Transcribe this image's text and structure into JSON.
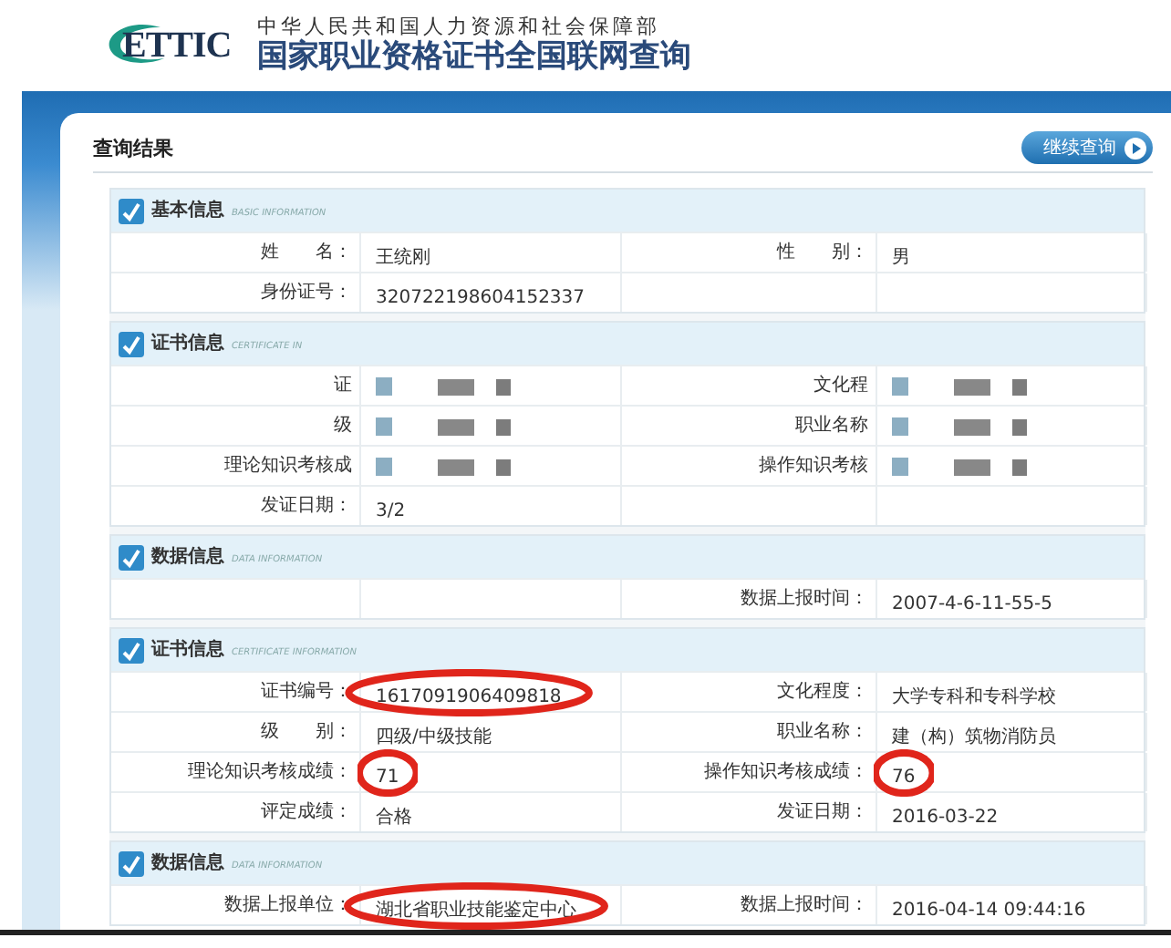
{
  "header": {
    "logo_text": "ETTIC",
    "ministry": "中华人民共和国人力资源和社会保障部",
    "title": "国家职业资格证书全国联网查询"
  },
  "result_title": "查询结果",
  "continue_button": "继续查询",
  "sections": [
    {
      "title": "基本信息",
      "subtitle": "BASIC INFORMATION",
      "rows": [
        {
          "left": {
            "label": "姓　　名：",
            "value": "王统刚",
            "circled": false
          },
          "right": {
            "label": "性　　别：",
            "value": "男",
            "circled": false
          }
        },
        {
          "left": {
            "label": "身份证号：",
            "value": "320722198604152337",
            "circled": false
          }
        }
      ]
    },
    {
      "title": "证书信息",
      "subtitle": "CERTIFICATE IN",
      "blurred": true,
      "rows": [
        {
          "left": {
            "label": "证"
          },
          "right": {
            "label": "文化程"
          }
        },
        {
          "left": {
            "label": "级"
          },
          "right": {
            "label": "职业名称"
          }
        },
        {
          "left": {
            "label": "理论知识考核成"
          },
          "right": {
            "label": "操作知识考核"
          }
        },
        {
          "left": {
            "label": "发证日期：",
            "value": "3/2",
            "circled": false
          }
        }
      ]
    },
    {
      "title": "数据信息",
      "subtitle": "DATA INFORMATION",
      "rows": [
        {
          "right": {
            "label": "数据上报时间：",
            "value": "2007-4-6-11-55-5",
            "circled": false
          }
        }
      ]
    },
    {
      "title": "证书信息",
      "subtitle": "CERTIFICATE INFORMATION",
      "rows": [
        {
          "left": {
            "label": "证书编号：",
            "value": "1617091906409818",
            "circled": true
          },
          "right": {
            "label": "文化程度：",
            "value": "大学专科和专科学校",
            "circled": false
          }
        },
        {
          "left": {
            "label": "级　　别：",
            "value": "四级/中级技能",
            "circled": false
          },
          "right": {
            "label": "职业名称：",
            "value": "建（构）筑物消防员",
            "circled": false
          }
        },
        {
          "left": {
            "label": "理论知识考核成绩：",
            "value": "71",
            "circled": true
          },
          "right": {
            "label": "操作知识考核成绩：",
            "value": "76",
            "circled": true
          }
        },
        {
          "left": {
            "label": "评定成绩：",
            "value": "合格",
            "circled": false
          },
          "right": {
            "label": "发证日期：",
            "value": "2016-03-22",
            "circled": false
          }
        }
      ]
    },
    {
      "title": "数据信息",
      "subtitle": "DATA INFORMATION",
      "rows": [
        {
          "left": {
            "label": "数据上报单位：",
            "value": "湖北省职业技能鉴定中心",
            "circled": true
          },
          "right": {
            "label": "数据上报时间：",
            "value": "2016-04-14 09:44:16",
            "circled": false
          }
        }
      ]
    }
  ]
}
